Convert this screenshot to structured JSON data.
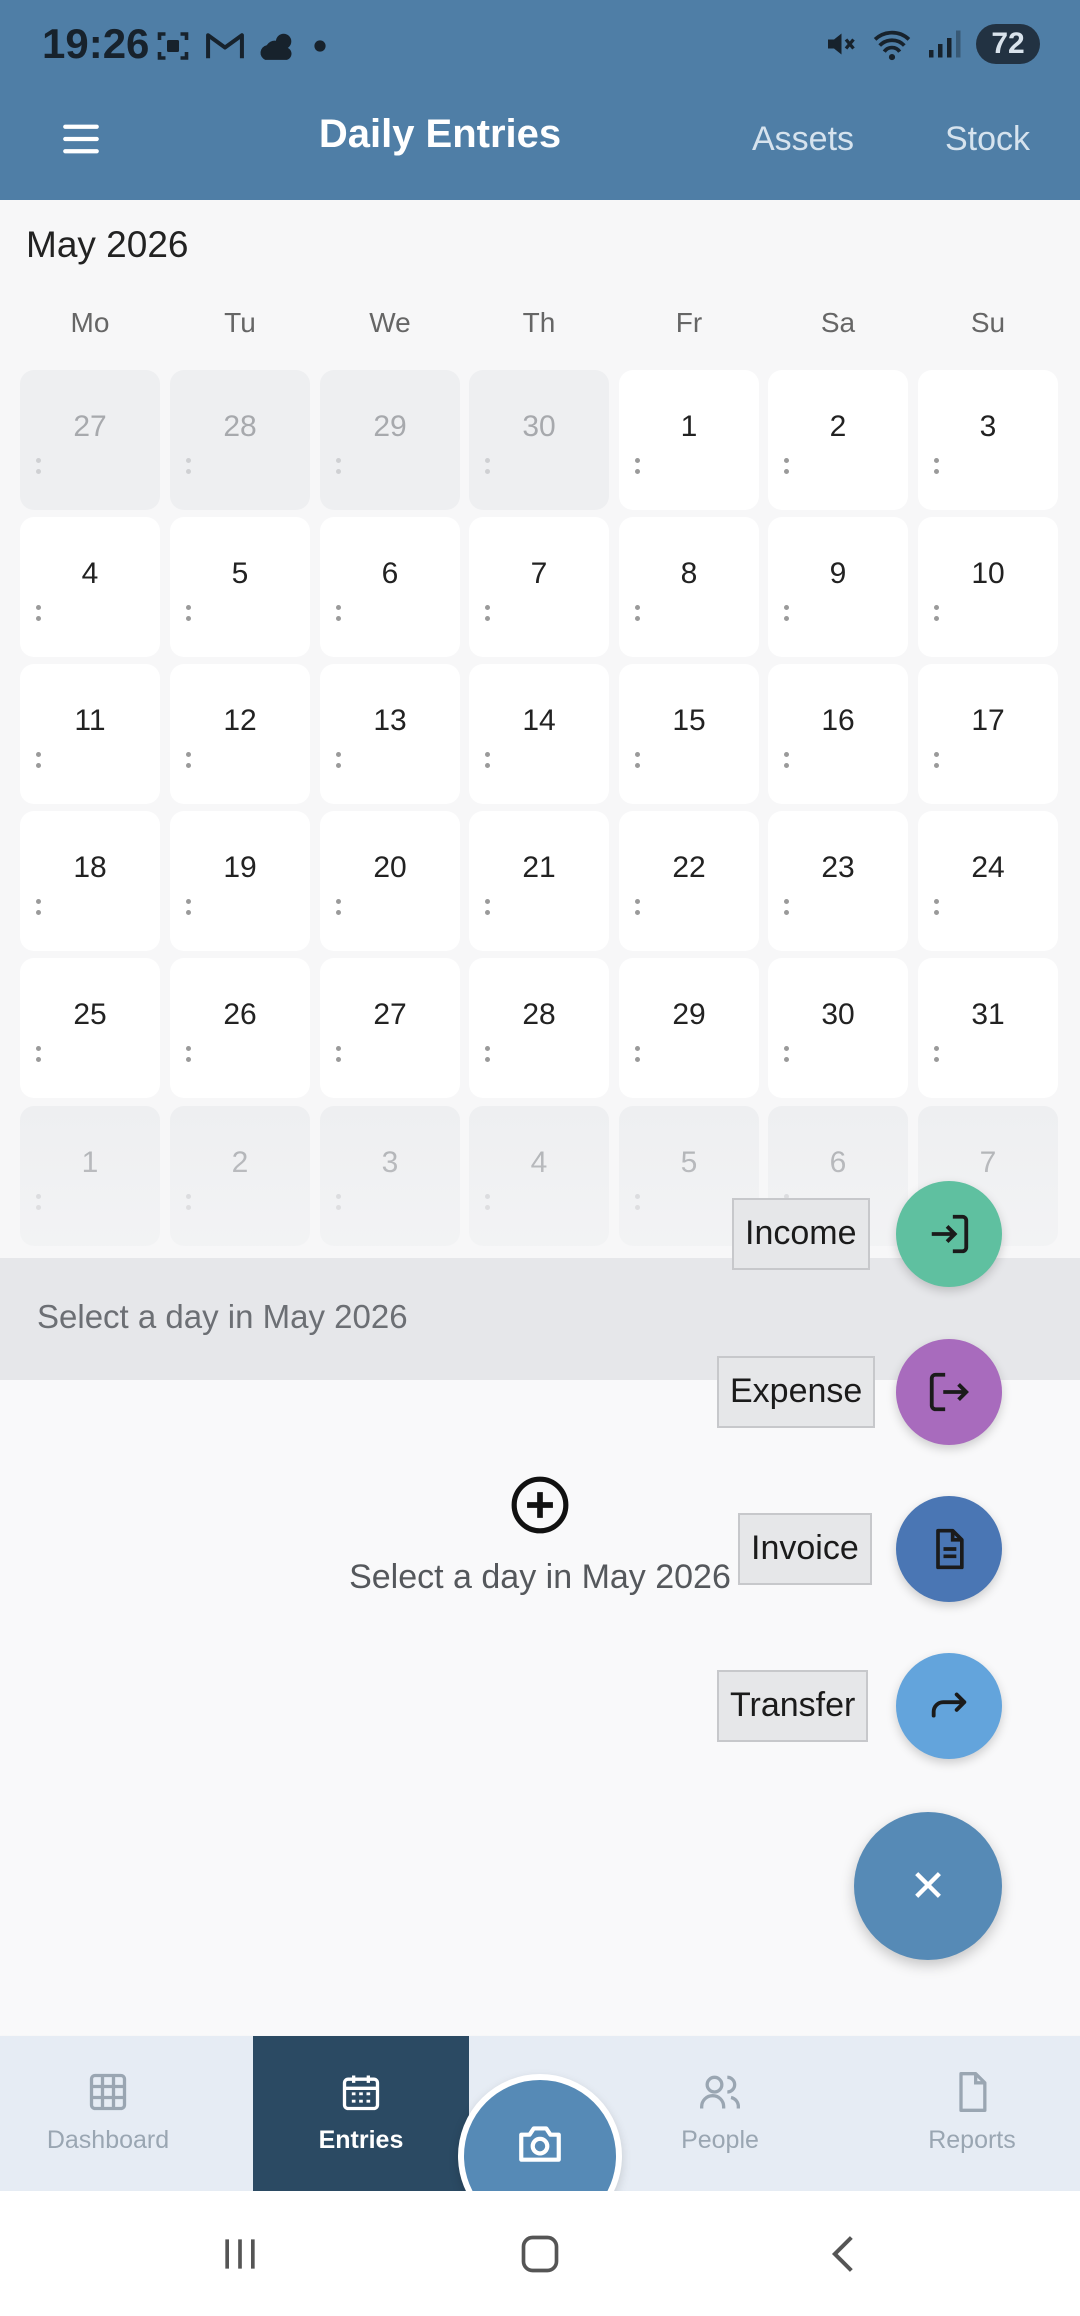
{
  "status_bar": {
    "time": "19:26",
    "battery": "72",
    "left_icons": [
      "screenshot-icon",
      "gmail-icon",
      "weather-icon",
      "dot-icon"
    ],
    "right_icons": [
      "mute-icon",
      "wifi-icon",
      "signal-icon"
    ]
  },
  "header": {
    "title": "Daily Entries",
    "links": [
      "Assets",
      "Stock"
    ],
    "bg_color": "#4f7ea6"
  },
  "calendar": {
    "month_label": "May 2026",
    "weekdays": [
      "Mo",
      "Tu",
      "We",
      "Th",
      "Fr",
      "Sa",
      "Su"
    ],
    "weeks": [
      [
        {
          "d": "27",
          "other": true
        },
        {
          "d": "28",
          "other": true
        },
        {
          "d": "29",
          "other": true
        },
        {
          "d": "30",
          "other": true
        },
        {
          "d": "1"
        },
        {
          "d": "2"
        },
        {
          "d": "3"
        }
      ],
      [
        {
          "d": "4"
        },
        {
          "d": "5"
        },
        {
          "d": "6"
        },
        {
          "d": "7"
        },
        {
          "d": "8"
        },
        {
          "d": "9"
        },
        {
          "d": "10"
        }
      ],
      [
        {
          "d": "11"
        },
        {
          "d": "12"
        },
        {
          "d": "13"
        },
        {
          "d": "14"
        },
        {
          "d": "15"
        },
        {
          "d": "16"
        },
        {
          "d": "17"
        }
      ],
      [
        {
          "d": "18"
        },
        {
          "d": "19"
        },
        {
          "d": "20"
        },
        {
          "d": "21"
        },
        {
          "d": "22"
        },
        {
          "d": "23"
        },
        {
          "d": "24"
        }
      ],
      [
        {
          "d": "25"
        },
        {
          "d": "26"
        },
        {
          "d": "27"
        },
        {
          "d": "28"
        },
        {
          "d": "29"
        },
        {
          "d": "30"
        },
        {
          "d": "31"
        }
      ],
      [
        {
          "d": "1",
          "other": true
        },
        {
          "d": "2",
          "other": true
        },
        {
          "d": "3",
          "other": true
        },
        {
          "d": "4",
          "other": true
        },
        {
          "d": "5",
          "other": true
        },
        {
          "d": "6",
          "other": true
        },
        {
          "d": "7",
          "other": true
        }
      ]
    ]
  },
  "selection_bar": {
    "text": "Select a day in May 2026"
  },
  "empty_state": {
    "icon": "plus-circle-icon",
    "text": "Select a day in May 2026"
  },
  "speed_dial": {
    "actions": [
      {
        "label": "Income",
        "icon": "login-arrow-icon",
        "color": "#5fc0a0"
      },
      {
        "label": "Expense",
        "icon": "logout-arrow-icon",
        "color": "#a86bbd"
      },
      {
        "label": "Invoice",
        "icon": "document-icon",
        "color": "#4a76b4"
      },
      {
        "label": "Transfer",
        "icon": "share-arrow-icon",
        "color": "#63a4dc"
      }
    ],
    "close_symbol": "✕",
    "close_color": "#568ab6"
  },
  "bottom_nav": {
    "items": [
      {
        "label": "Dashboard",
        "icon": "grid-icon",
        "active": false
      },
      {
        "label": "Entries",
        "icon": "calendar-icon",
        "active": true
      },
      {
        "label": "People",
        "icon": "people-icon",
        "active": false
      },
      {
        "label": "Reports",
        "icon": "document-icon",
        "active": false
      }
    ],
    "center_icon": "camera-icon",
    "active_color": "#2b4a63"
  },
  "system_nav": [
    "recents-icon",
    "home-icon",
    "back-icon"
  ]
}
